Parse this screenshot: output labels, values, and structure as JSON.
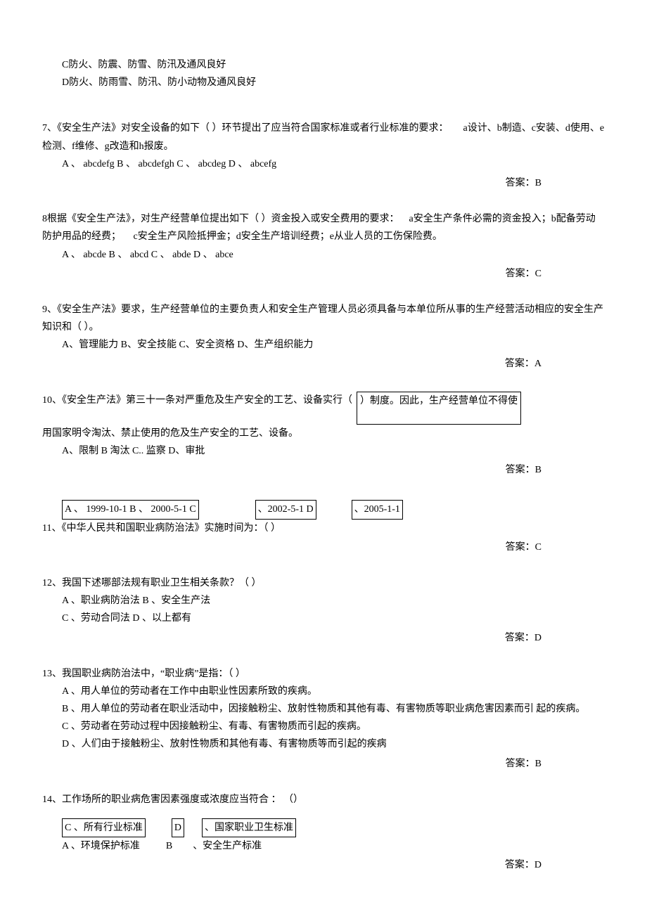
{
  "top": {
    "optC": "C防火、防震、防雪、防汛及通风良好",
    "optD": "D防火、防雨雪、防汛、防小动物及通风良好"
  },
  "q7": {
    "stem_a": "7、《安全生产法》对安全设备的如下（        ）环节提出了应当符合国家标准或者行业标准的要求：",
    "stem_b": "a设计、b制造、c安装、d使用、e检测、f维修、g改造和h报废。",
    "opts": "A 、 abcdefg B 、 abcdefgh C 、 abcdeg D 、 abcefg",
    "answer": "答案：B"
  },
  "q8": {
    "stem_a": "8根据《安全生产法》，对生产经营单位提出如下（            ）资金投入或安全费用的要求：",
    "stem_b": "a安全生产条件必需的资金投入；b配备劳动防护用品的经费；",
    "stem_c": "c安全生产风险抵押金；d安全生产培训经费；e从业人员的工伤保险费。",
    "opts": "A 、   abcde B 、   abcd C 、   abde D 、   abce",
    "answer": "答案：C"
  },
  "q9": {
    "stem_a": "9、《安全生产法》要求，生产经营单位的主要负责人和安全生产管理人员必须具备与本单位所从事的生产经营活动相应的安全生产知识和（       ）。",
    "opts": "A、管理能力 B、安全技能 C、安全资格 D、生产组织能力",
    "answer": "答案：A"
  },
  "q10": {
    "stem_left": "10、《安全生产法》第三十一条对严重危及生产安全的工艺、设备实行（",
    "stem_box": "）制度。因此，生产经营单位不得使",
    "stem_next": "用国家明令淘汰、禁止使用的危及生产安全的工艺、设备。",
    "opts": "A、限制 B 淘汰 C.. 监察 D、审批",
    "answer": "答案：B"
  },
  "q11": {
    "box1": "A 、  1999-10-1 B 、  2000-5-1 C",
    "box2": "、2002-5-1 D",
    "box3": "、2005-1-1",
    "stem": "11、《中华人民共和国职业病防治法》实施时间为：（          ）",
    "answer": "答案：C"
  },
  "q12": {
    "stem": "12、我国下述哪部法规有职业卫生相关条款？（        ）",
    "optsA": "A 、职业病防治法 B 、安全生产法",
    "optsB": "C 、劳动合同法 D 、以上都有",
    "answer": "答案：D"
  },
  "q13": {
    "stem": "13、我国职业病防治法中，“职业病”是指：（        ）",
    "a": "A 、用人单位的劳动者在工作中由职业性因素所致的疾病。",
    "b": "B 、用人单位的劳动者在职业活动中，因接触粉尘、放射性物质和其他有毒、有害物质等职业病危害因素而引 起的疾病。",
    "c": "C 、劳动者在劳动过程中因接触粉尘、有毒、有害物质而引起的疾病。",
    "d": "D 、人们由于接触粉尘、放射性物质和其他有毒、有害物质等而引起的疾病",
    "answer": "答案：B"
  },
  "q14": {
    "stem": "14、工作场所的职业病危害因素强度或浓度应当符合       ： （）",
    "box_c": "C 、所有行业标准",
    "box_d_label": "D",
    "box_d_text": "、国家职业卫生标准",
    "line2_a": "A 、环境保护标准",
    "line2_b_label": "B",
    "line2_b_text": "、安全生产标准",
    "answer": "答案：D"
  }
}
